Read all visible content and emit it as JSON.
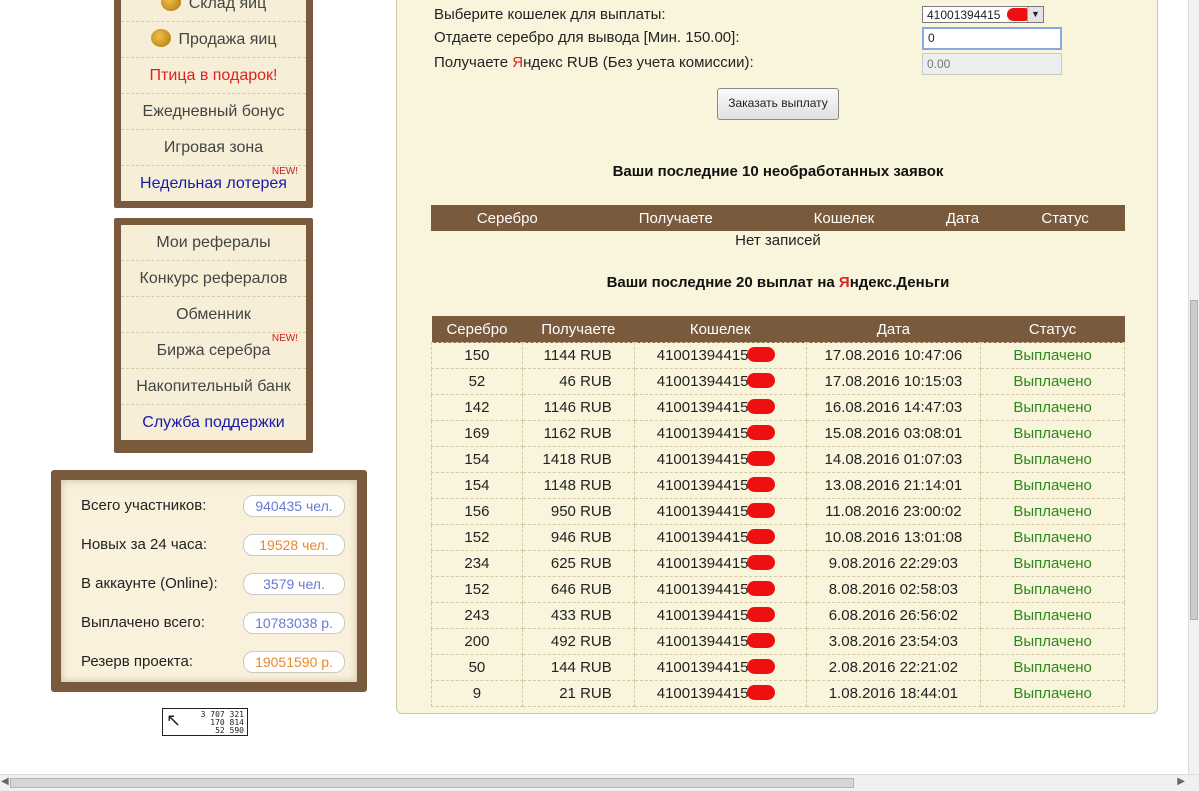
{
  "menu1": {
    "items": [
      {
        "label": "Склад яиц",
        "icon": "basket-icon",
        "style": "plain"
      },
      {
        "label": "Продажа яиц",
        "icon": "coins-icon",
        "style": "plain"
      },
      {
        "label": "Птица в подарок!",
        "style": "red"
      },
      {
        "label": "Ежедневный бонус",
        "style": "plain"
      },
      {
        "label": "Игровая зона",
        "style": "plain"
      },
      {
        "label": "Недельная лотерея",
        "style": "blue",
        "badge": "NEW!"
      }
    ]
  },
  "menu2": {
    "items": [
      {
        "label": "Мои рефералы"
      },
      {
        "label": "Конкурс рефералов"
      },
      {
        "label": "Обменник"
      },
      {
        "label": "Биржа серебра",
        "badge": "NEW!"
      },
      {
        "label": "Накопительный банк"
      },
      {
        "label": "Служба поддержки",
        "style": "blue"
      }
    ]
  },
  "stats": [
    {
      "label": "Всего участников:",
      "value": "940435 чел.",
      "color": "#6a78d8"
    },
    {
      "label": "Новых за 24 часа:",
      "value": "19528 чел.",
      "color": "#e8892a"
    },
    {
      "label": "В аккаунте (Online):",
      "value": "3579 чел.",
      "color": "#6a78d8"
    },
    {
      "label": "Выплачено всего:",
      "value": "10783038 р.",
      "color": "#6a78d8"
    },
    {
      "label": "Резерв проекта:",
      "value": "19051590 р.",
      "color": "#e8892a"
    }
  ],
  "counter": {
    "line1": "3 707 321",
    "line2": "170 814",
    "line3": "52 590"
  },
  "form": {
    "wallet_label": "Выберите кошелек для выплаты:",
    "wallet_value": "41001394415",
    "silver_label": "Отдаете серебро для вывода [Мин. 150.00]:",
    "silver_value": "0",
    "receive_label_pre": "Получаете ",
    "receive_label_ya": "Я",
    "receive_label_post": "ндекс RUB (Без учета комиссии):",
    "receive_value": "0.00",
    "order_button": "Заказать выплату"
  },
  "pending": {
    "title": "Ваши последние 10 необработанных заявок",
    "headers": [
      "Серебро",
      "Получаете",
      "Кошелек",
      "Дата",
      "Статус"
    ],
    "empty_text": "Нет записей"
  },
  "payouts": {
    "title_pre": "Ваши последние 20 выплат на ",
    "title_ya": "Я",
    "title_post": "ндекс.Деньги",
    "headers": [
      "Серебро",
      "Получаете",
      "Кошелек",
      "Дата",
      "Статус"
    ],
    "rows": [
      {
        "silver": "150",
        "rub": "1144 RUB",
        "wallet": "41001394415",
        "date": "17.08.2016 10:47:06",
        "status": "Выплачено"
      },
      {
        "silver": "52",
        "rub": "46 RUB",
        "wallet": "41001394415",
        "date": "17.08.2016 10:15:03",
        "status": "Выплачено"
      },
      {
        "silver": "142",
        "rub": "1146 RUB",
        "wallet": "41001394415",
        "date": "16.08.2016 14:47:03",
        "status": "Выплачено"
      },
      {
        "silver": "169",
        "rub": "1162 RUB",
        "wallet": "41001394415",
        "date": "15.08.2016 03:08:01",
        "status": "Выплачено"
      },
      {
        "silver": "154",
        "rub": "1418 RUB",
        "wallet": "41001394415",
        "date": "14.08.2016 01:07:03",
        "status": "Выплачено"
      },
      {
        "silver": "154",
        "rub": "1148 RUB",
        "wallet": "41001394415",
        "date": "13.08.2016 21:14:01",
        "status": "Выплачено"
      },
      {
        "silver": "156",
        "rub": "950 RUB",
        "wallet": "41001394415",
        "date": "11.08.2016 23:00:02",
        "status": "Выплачено"
      },
      {
        "silver": "152",
        "rub": "946 RUB",
        "wallet": "41001394415",
        "date": "10.08.2016 13:01:08",
        "status": "Выплачено"
      },
      {
        "silver": "234",
        "rub": "625 RUB",
        "wallet": "41001394415",
        "date": "9.08.2016 22:29:03",
        "status": "Выплачено"
      },
      {
        "silver": "152",
        "rub": "646 RUB",
        "wallet": "41001394415",
        "date": "8.08.2016 02:58:03",
        "status": "Выплачено"
      },
      {
        "silver": "243",
        "rub": "433 RUB",
        "wallet": "41001394415",
        "date": "6.08.2016 26:56:02",
        "status": "Выплачено"
      },
      {
        "silver": "200",
        "rub": "492 RUB",
        "wallet": "41001394415",
        "date": "3.08.2016 23:54:03",
        "status": "Выплачено"
      },
      {
        "silver": "50",
        "rub": "144 RUB",
        "wallet": "41001394415",
        "date": "2.08.2016 22:21:02",
        "status": "Выплачено"
      },
      {
        "silver": "9",
        "rub": "21 RUB",
        "wallet": "41001394415",
        "date": "1.08.2016 18:44:01",
        "status": "Выплачено"
      }
    ]
  },
  "colors": {
    "brown": "#7a5a3c",
    "panel": "#f9f4dc",
    "paid": "#2a8a1a",
    "yandex_red": "#e02020"
  }
}
